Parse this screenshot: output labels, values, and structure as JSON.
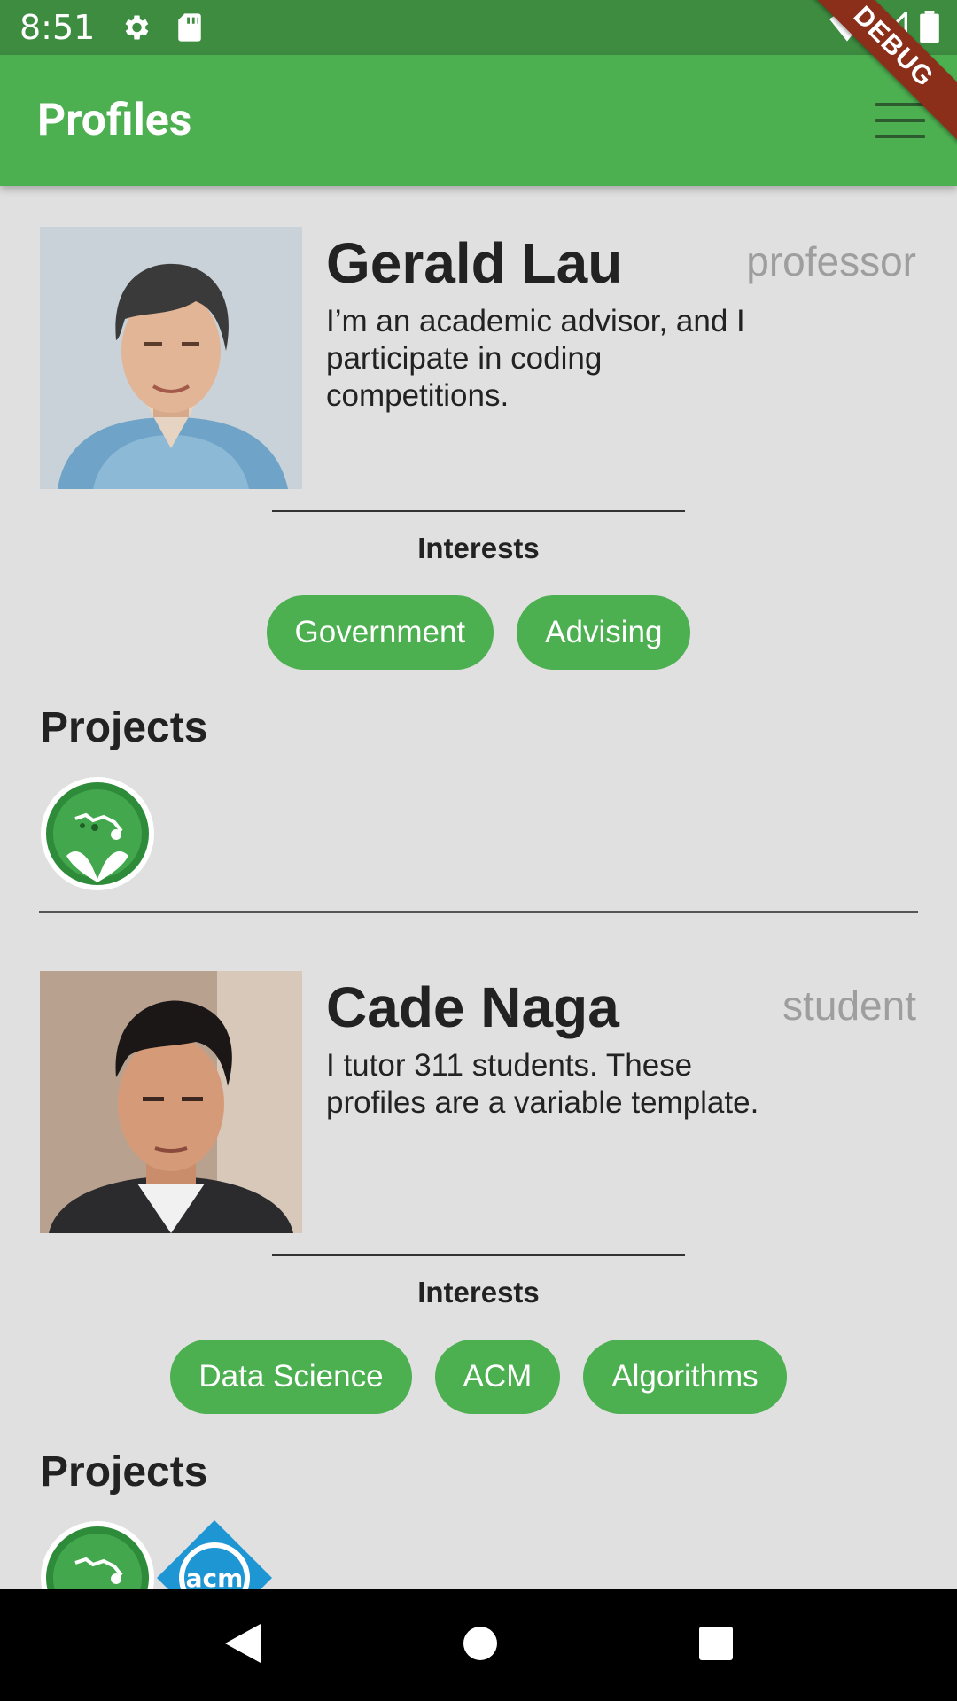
{
  "status_bar": {
    "time": "8:51"
  },
  "app_bar": {
    "title": "Profiles"
  },
  "debug_banner": "DEBUG",
  "profiles": [
    {
      "name": "Gerald Lau",
      "role": "professor",
      "bio": "I’m an academic advisor, and I participate in coding competitions.",
      "interests_heading": "Interests",
      "interests": [
        "Government",
        "Advising"
      ],
      "projects_heading": "Projects",
      "projects": [
        "hawaii-green-project"
      ]
    },
    {
      "name": "Cade Naga",
      "role": "student",
      "bio": "I tutor 311 students. These profiles are a variable template.",
      "interests_heading": "Interests",
      "interests": [
        "Data Science",
        "ACM",
        "Algorithms"
      ],
      "projects_heading": "Projects",
      "projects": [
        "hawaii-green-project",
        "acm-project"
      ]
    }
  ],
  "colors": {
    "app_bar": "#4caf50",
    "status_bar": "#3d8c40",
    "chip": "#4caf50",
    "background": "#e0e0e0",
    "role_text": "#9e9e9e"
  }
}
